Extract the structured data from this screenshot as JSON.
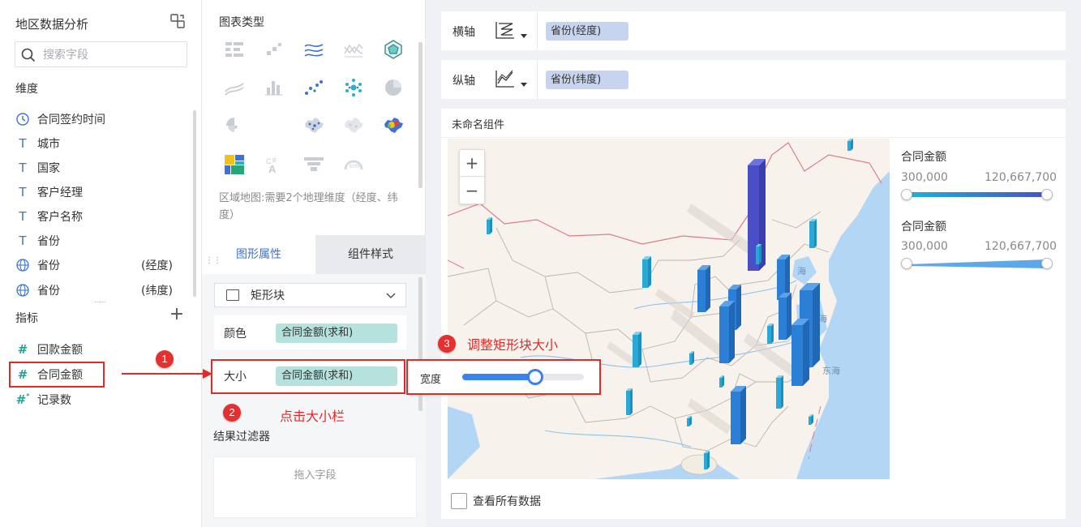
{
  "left": {
    "title": "地区数据分析",
    "search_placeholder": "搜索字段",
    "dimensions_label": "维度",
    "dimensions": [
      {
        "icon": "clock-icon",
        "label": "合同签约时间",
        "sub": ""
      },
      {
        "icon": "text-icon",
        "label": "城市",
        "sub": ""
      },
      {
        "icon": "text-icon",
        "label": "国家",
        "sub": ""
      },
      {
        "icon": "text-icon",
        "label": "客户经理",
        "sub": ""
      },
      {
        "icon": "text-icon",
        "label": "客户名称",
        "sub": ""
      },
      {
        "icon": "text-icon",
        "label": "省份",
        "sub": ""
      },
      {
        "icon": "globe-icon",
        "label": "省份",
        "sub": "(经度)"
      },
      {
        "icon": "globe-icon",
        "label": "省份",
        "sub": "(纬度)"
      }
    ],
    "measures_label": "指标",
    "measures": [
      {
        "icon": "hash-icon",
        "label": "回款金额"
      },
      {
        "icon": "hash-icon",
        "label": "合同金额"
      },
      {
        "icon": "hash-star-icon",
        "label": "记录数"
      }
    ]
  },
  "middle": {
    "chart_type_title": "图表类型",
    "chart_desc": "区域地图:需要2个地理维度（经度、纬度）",
    "tabs": {
      "prop": "图形属性",
      "style": "组件样式"
    },
    "shape": "矩形块",
    "color_label": "颜色",
    "color_field": "合同金额(求和)",
    "size_label": "大小",
    "size_field": "合同金额(求和)",
    "filter_title": "结果过滤器",
    "filter_placeholder": "拖入字段"
  },
  "axes": {
    "x_label": "横轴",
    "x_field": "省份(经度)",
    "y_label": "纵轴",
    "y_field": "省份(纬度)"
  },
  "component_name": "未命名组件",
  "map_labels": {
    "bohai": "海",
    "yellow_sea": "海",
    "east_sea": "东海"
  },
  "legend": [
    {
      "title": "合同金额",
      "min": "300,000",
      "max": "120,667,700"
    },
    {
      "title": "合同金额",
      "min": "300,000",
      "max": "120,667,700"
    }
  ],
  "width_popup": {
    "label": "宽度",
    "value": 0.6
  },
  "view_all": "查看所有数据",
  "annotations": {
    "b1": "1",
    "b2": "2",
    "b3": "3",
    "note2": "点击大小栏",
    "note3": "调整矩形块大小"
  },
  "colors": {
    "accent": "#3b73d6",
    "annotation": "#e02b2b",
    "bar_dark": "#4a4fc8",
    "bar_blue": "#2b7fd4"
  }
}
